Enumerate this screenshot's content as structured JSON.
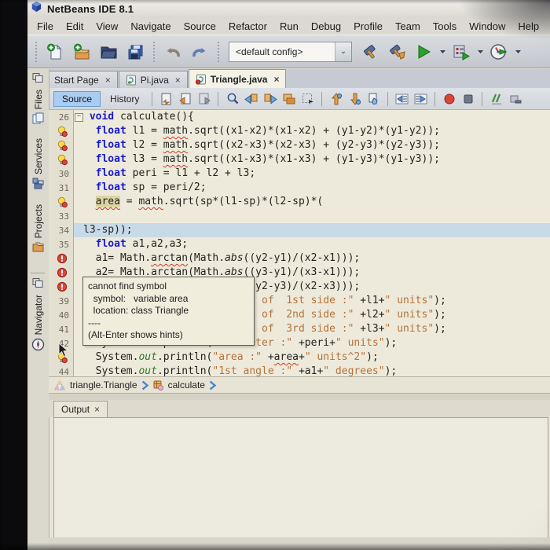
{
  "window": {
    "title": "NetBeans IDE 8.1"
  },
  "menu": {
    "items": [
      "File",
      "Edit",
      "View",
      "Navigate",
      "Source",
      "Refactor",
      "Run",
      "Debug",
      "Profile",
      "Team",
      "Tools",
      "Window",
      "Help"
    ]
  },
  "toolbar": {
    "config_value": "<default config>",
    "file_group": [
      "new-file",
      "new-project",
      "open-project",
      "save-all"
    ],
    "history_group": [
      "undo",
      "redo"
    ],
    "build_group": [
      "build-project",
      "clean-build-project"
    ],
    "run_group": [
      "run-project",
      "debug-project",
      "profile-project"
    ]
  },
  "tabs": {
    "close_glyph": "×",
    "items": [
      {
        "label": "Start Page",
        "icon": "none",
        "active": false
      },
      {
        "label": "Pi.java",
        "icon": "java-file",
        "active": false
      },
      {
        "label": "Triangle.java",
        "icon": "java-file-error",
        "active": true
      }
    ]
  },
  "editor_toolbar": {
    "source_label": "Source",
    "history_label": "History",
    "icon_groups": [
      [
        "last-edit",
        "back",
        "forward"
      ],
      [
        "find-selection",
        "find-previous",
        "find-next",
        "toggle-highlight",
        "rectangular-selection"
      ],
      [
        "previous-bookmark",
        "next-bookmark",
        "toggle-bookmark"
      ],
      [
        "shift-line-left",
        "shift-line-right"
      ],
      [
        "start-macro-recording",
        "stop-macro-recording"
      ],
      [
        "comment",
        "uncomment"
      ]
    ]
  },
  "sidebar": {
    "groups": [
      {
        "dock_icon": true,
        "tabs": [
          {
            "label": "Files",
            "icon": "files"
          },
          {
            "label": "Services",
            "icon": "services"
          },
          {
            "label": "Projects",
            "icon": "projects"
          }
        ]
      },
      {
        "dock_icon": true,
        "tabs": [
          {
            "label": "Navigator",
            "icon": "navigator"
          }
        ]
      }
    ]
  },
  "code": {
    "lines": [
      {
        "num": "26",
        "gutter": "num",
        "fold": true,
        "indent": 1,
        "tokens": [
          [
            "k",
            "void"
          ],
          [
            "p",
            " calculate(){"
          ]
        ]
      },
      {
        "num": "27",
        "gutter": "bulb",
        "indent": 2,
        "tokens": [
          [
            "k",
            "float"
          ],
          [
            "p",
            " l1 = "
          ],
          [
            "e",
            "math"
          ],
          [
            "p",
            ".sqrt((x1-x2)*(x1-x2) + (y1-y2)*(y1-y2));"
          ]
        ]
      },
      {
        "num": "28",
        "gutter": "bulb",
        "indent": 2,
        "tokens": [
          [
            "k",
            "float"
          ],
          [
            "p",
            " l2 = "
          ],
          [
            "e",
            "math"
          ],
          [
            "p",
            ".sqrt((x2-x3)*(x2-x3) + (y2-y3)*(y2-y3));"
          ]
        ]
      },
      {
        "num": "29",
        "gutter": "bulb",
        "indent": 2,
        "tokens": [
          [
            "k",
            "float"
          ],
          [
            "p",
            " l3 = "
          ],
          [
            "e",
            "math"
          ],
          [
            "p",
            ".sqrt((x1-x3)*(x1-x3) + (y1-y3)*(y1-y3));"
          ]
        ]
      },
      {
        "num": "30",
        "gutter": "num",
        "indent": 2,
        "tokens": [
          [
            "k",
            "float"
          ],
          [
            "p",
            " peri = l1 + l2 + l3;"
          ]
        ]
      },
      {
        "num": "31",
        "gutter": "num",
        "indent": 2,
        "tokens": [
          [
            "k",
            "float"
          ],
          [
            "p",
            " sp = peri/2;"
          ]
        ]
      },
      {
        "num": "32",
        "gutter": "bulb",
        "indent": 2,
        "tokens": [
          [
            "he",
            "area"
          ],
          [
            "p",
            " = "
          ],
          [
            "e",
            "math"
          ],
          [
            "p",
            ".sqrt(sp*(l1-sp)*(l2-sp)*("
          ]
        ]
      },
      {
        "num": "33",
        "gutter": "num",
        "indent": 0,
        "tokens": []
      },
      {
        "num": "34",
        "gutter": "num",
        "indent": 0,
        "cur": true,
        "tokens": [
          [
            "p",
            "l3-sp));"
          ]
        ]
      },
      {
        "num": "35",
        "gutter": "num",
        "indent": 2,
        "tokens": [
          [
            "k",
            "float"
          ],
          [
            "p",
            " a1,a2,a3;"
          ]
        ]
      },
      {
        "num": "36",
        "gutter": "error",
        "indent": 2,
        "tokens": [
          [
            "p",
            "a1= Math."
          ],
          [
            "e",
            "arctan"
          ],
          [
            "p",
            "(Math."
          ],
          [
            "i",
            "abs"
          ],
          [
            "p",
            "((y2-y1)/(x2-x1)));"
          ]
        ]
      },
      {
        "num": "37",
        "gutter": "error",
        "indent": 2,
        "tokens": [
          [
            "p",
            "a2= Math."
          ],
          [
            "e",
            "arctan"
          ],
          [
            "p",
            "(Math."
          ],
          [
            "i",
            "abs"
          ],
          [
            "p",
            "((y3-y1)/(x3-x1)));"
          ]
        ]
      },
      {
        "num": "38",
        "gutter": "error",
        "indent": 2,
        "tokens": [
          [
            "p",
            "a3= Math."
          ],
          [
            "e",
            "arctan"
          ],
          [
            "p",
            "(Math."
          ],
          [
            "i",
            "abs"
          ],
          [
            "p",
            "((y2-y3)/(x2-x3)));"
          ]
        ]
      },
      {
        "num": "39",
        "gutter": "num",
        "indent": 2,
        "tokens": [
          [
            "p",
            "System."
          ],
          [
            "g",
            "out"
          ],
          [
            "p",
            ".println("
          ],
          [
            "s",
            "\"length of  1st side :\""
          ],
          [
            "p",
            " +l1+"
          ],
          [
            "s",
            "\" units\""
          ],
          [
            "p",
            ");"
          ]
        ]
      },
      {
        "num": "40",
        "gutter": "num",
        "indent": 2,
        "tokens": [
          [
            "p",
            "System."
          ],
          [
            "g",
            "out"
          ],
          [
            "p",
            ".println("
          ],
          [
            "s",
            "\"length of  2nd side :\""
          ],
          [
            "p",
            " +l2+"
          ],
          [
            "s",
            "\" units\""
          ],
          [
            "p",
            ");"
          ]
        ]
      },
      {
        "num": "41",
        "gutter": "num",
        "indent": 2,
        "tokens": [
          [
            "p",
            "System."
          ],
          [
            "g",
            "out"
          ],
          [
            "p",
            ".println("
          ],
          [
            "s",
            "\"length of  3rd side :\""
          ],
          [
            "p",
            " +l3+"
          ],
          [
            "s",
            "\" units\""
          ],
          [
            "p",
            ");"
          ]
        ]
      },
      {
        "num": "42",
        "gutter": "num",
        "indent": 2,
        "tokens": [
          [
            "p",
            "System."
          ],
          [
            "g",
            "out"
          ],
          [
            "p",
            ".println("
          ],
          [
            "s",
            "\"Perimeter :\""
          ],
          [
            "p",
            " +peri+"
          ],
          [
            "s",
            "\" units\""
          ],
          [
            "p",
            ");"
          ]
        ]
      },
      {
        "num": "43",
        "gutter": "bulb",
        "indent": 2,
        "tokens": [
          [
            "p",
            "System."
          ],
          [
            "g",
            "out"
          ],
          [
            "p",
            ".println("
          ],
          [
            "s",
            "\"area :\""
          ],
          [
            "p",
            " +"
          ],
          [
            "e",
            "area"
          ],
          [
            "p",
            "+"
          ],
          [
            "s",
            "\" units^2\""
          ],
          [
            "p",
            ");"
          ]
        ]
      },
      {
        "num": "44",
        "gutter": "num",
        "indent": 2,
        "tokens": [
          [
            "p",
            "System."
          ],
          [
            "g",
            "out"
          ],
          [
            "p",
            ".println("
          ],
          [
            "s",
            "\"1st angle :\""
          ],
          [
            "p",
            " +a1+"
          ],
          [
            "s",
            "\" degrees\""
          ],
          [
            "p",
            ");"
          ]
        ]
      }
    ]
  },
  "tooltip": {
    "lines": [
      "cannot find symbol",
      "  symbol:   variable area",
      "  location: class Triangle",
      "----",
      "(Alt-Enter shows hints)"
    ]
  },
  "breadcrumb": {
    "items": [
      {
        "icon": "class-triangle",
        "label": "triangle.Triangle"
      },
      {
        "icon": "method",
        "label": "calculate"
      }
    ]
  },
  "output": {
    "tab_label": "Output",
    "close_glyph": "×"
  },
  "colors": {
    "keyword": "#1a1acc",
    "string": "#b5733a",
    "static_field": "#2a7a2a",
    "error_underline": "#cc3a28",
    "current_line": "#c8dae8",
    "occurrence_highlight": "#dcd5a2",
    "source_button_bg": "#a9cdf2"
  }
}
